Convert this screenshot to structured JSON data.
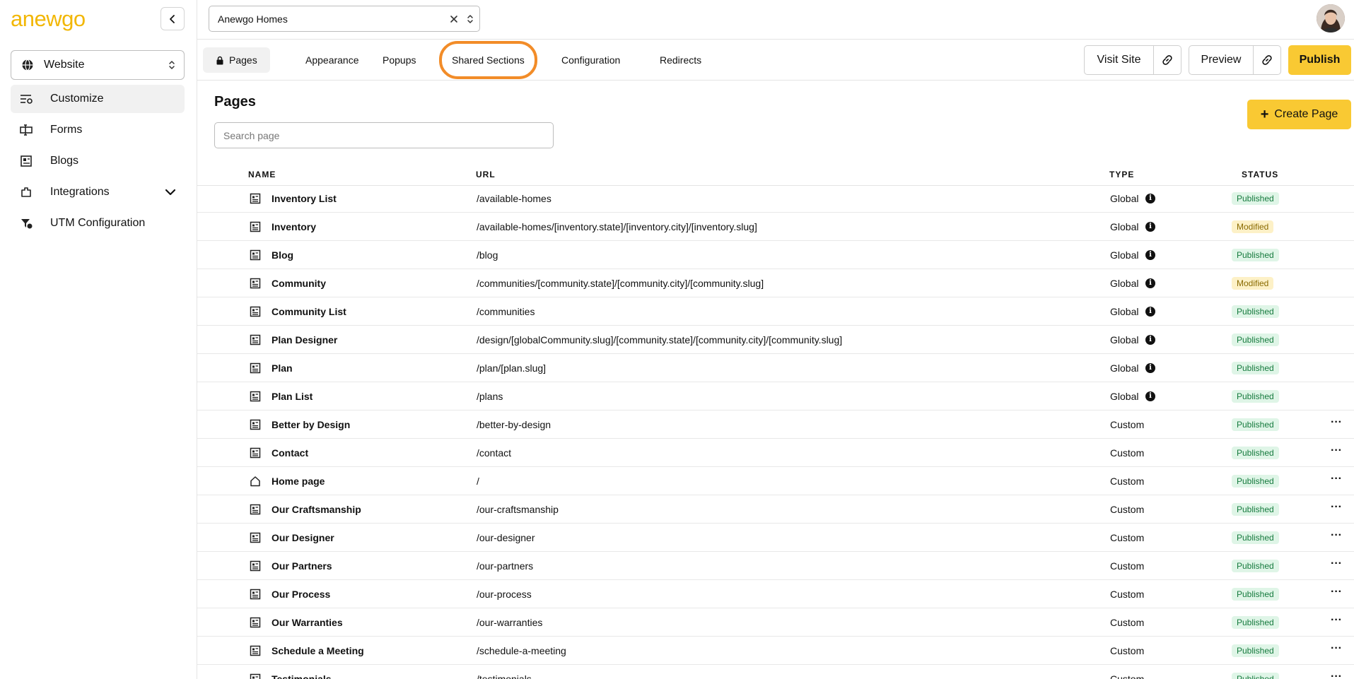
{
  "brand": {
    "logo_text_a": "a",
    "logo_text_rest": "newgo",
    "accent": "#f2b705",
    "highlight": "#f28c28"
  },
  "sidebar": {
    "site_selector": "Website",
    "items": [
      {
        "label": "Customize",
        "icon": "customize-icon",
        "active": true
      },
      {
        "label": "Forms",
        "icon": "forms-icon"
      },
      {
        "label": "Blogs",
        "icon": "blogs-icon"
      },
      {
        "label": "Integrations",
        "icon": "integrations-icon",
        "expandable": true
      },
      {
        "label": "UTM Configuration",
        "icon": "utm-icon"
      }
    ]
  },
  "topbar": {
    "project": "Anewgo Homes"
  },
  "tabs": {
    "items": [
      "Pages",
      "Appearance",
      "Popups",
      "Shared Sections",
      "Configuration",
      "Redirects"
    ],
    "active": "Pages",
    "highlighted": "Shared Sections"
  },
  "actions": {
    "visit_site": "Visit Site",
    "preview": "Preview",
    "publish": "Publish"
  },
  "pages": {
    "title": "Pages",
    "create_label": "Create Page",
    "search_placeholder": "Search page",
    "columns": {
      "name": "NAME",
      "url": "URL",
      "type": "TYPE",
      "status": "STATUS"
    },
    "rows": [
      {
        "name": "Inventory List",
        "url": "/available-homes",
        "type": "Global",
        "status": "Published"
      },
      {
        "name": "Inventory",
        "url": "/available-homes/[inventory.state]/[inventory.city]/[inventory.slug]",
        "type": "Global",
        "status": "Modified"
      },
      {
        "name": "Blog",
        "url": "/blog",
        "type": "Global",
        "status": "Published"
      },
      {
        "name": "Community",
        "url": "/communities/[community.state]/[community.city]/[community.slug]",
        "type": "Global",
        "status": "Modified"
      },
      {
        "name": "Community List",
        "url": "/communities",
        "type": "Global",
        "status": "Published"
      },
      {
        "name": "Plan Designer",
        "url": "/design/[globalCommunity.slug]/[community.state]/[community.city]/[community.slug]",
        "type": "Global",
        "status": "Published"
      },
      {
        "name": "Plan",
        "url": "/plan/[plan.slug]",
        "type": "Global",
        "status": "Published"
      },
      {
        "name": "Plan List",
        "url": "/plans",
        "type": "Global",
        "status": "Published"
      },
      {
        "name": "Better by Design",
        "url": "/better-by-design",
        "type": "Custom",
        "status": "Published"
      },
      {
        "name": "Contact",
        "url": "/contact",
        "type": "Custom",
        "status": "Published"
      },
      {
        "name": "Home page",
        "url": "/",
        "type": "Custom",
        "status": "Published",
        "home": true
      },
      {
        "name": "Our Craftsmanship",
        "url": "/our-craftsmanship",
        "type": "Custom",
        "status": "Published"
      },
      {
        "name": "Our Designer",
        "url": "/our-designer",
        "type": "Custom",
        "status": "Published"
      },
      {
        "name": "Our Partners",
        "url": "/our-partners",
        "type": "Custom",
        "status": "Published"
      },
      {
        "name": "Our Process",
        "url": "/our-process",
        "type": "Custom",
        "status": "Published"
      },
      {
        "name": "Our Warranties",
        "url": "/our-warranties",
        "type": "Custom",
        "status": "Published"
      },
      {
        "name": "Schedule a Meeting",
        "url": "/schedule-a-meeting",
        "type": "Custom",
        "status": "Published"
      },
      {
        "name": "Testimonials",
        "url": "/testimonials",
        "type": "Custom",
        "status": "Published"
      }
    ]
  }
}
